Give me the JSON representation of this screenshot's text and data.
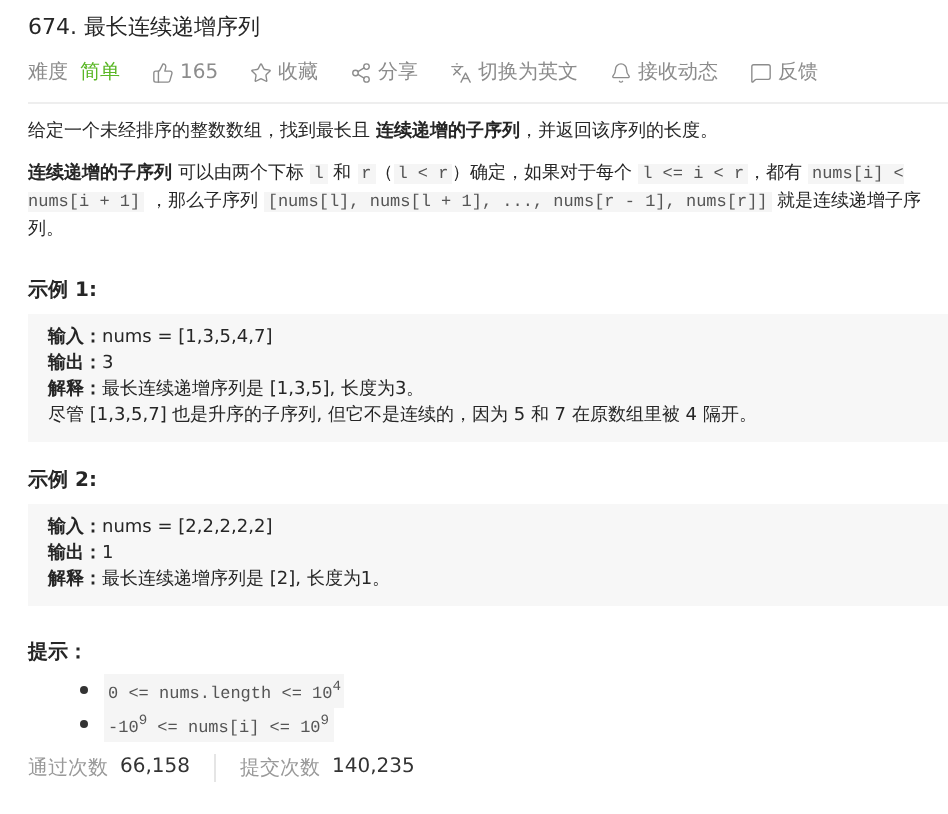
{
  "title": "674. 最长连续递增序列",
  "meta": {
    "difficulty_label": "难度",
    "difficulty": {
      "text": "简单",
      "kind": "easy"
    },
    "actions": [
      {
        "kind": "like",
        "label": "165"
      },
      {
        "kind": "star",
        "label": "收藏"
      },
      {
        "kind": "share",
        "label": "分享"
      },
      {
        "kind": "translate",
        "label": "切换为英文"
      },
      {
        "kind": "bell",
        "label": "接收动态"
      },
      {
        "kind": "feedback",
        "label": "反馈"
      }
    ]
  },
  "description": [
    [
      {
        "kind": "text",
        "text": "给定一个未经排序的整数数组，找到最长且 "
      },
      {
        "kind": "bold",
        "text": "连续递增的子序列"
      },
      {
        "kind": "text",
        "text": "，并返回该序列的长度。"
      }
    ],
    [
      {
        "kind": "bold",
        "text": "连续递增的子序列"
      },
      {
        "kind": "text",
        "text": " 可以由两个下标 "
      },
      {
        "kind": "code",
        "text": "l"
      },
      {
        "kind": "text",
        "text": " 和 "
      },
      {
        "kind": "code",
        "text": "r"
      },
      {
        "kind": "text",
        "text": "（"
      },
      {
        "kind": "code",
        "text": "l < r"
      },
      {
        "kind": "text",
        "text": "）确定，如果对于每个 "
      },
      {
        "kind": "code",
        "text": "l <= i < r"
      },
      {
        "kind": "text",
        "text": "，都有 "
      },
      {
        "kind": "code",
        "text": "nums[i] < nums[i + 1]"
      },
      {
        "kind": "text",
        "text": " ，那么子序列 "
      },
      {
        "kind": "code",
        "text": "[nums[l], nums[l + 1], ..., nums[r - 1], nums[r]]"
      },
      {
        "kind": "text",
        "text": " 就是连续递增子序列。"
      }
    ]
  ],
  "examples": [
    {
      "title": "示例 1:",
      "lines": [
        {
          "label": "输入：",
          "text": "nums = [1,3,5,4,7]"
        },
        {
          "label": "输出：",
          "text": "3"
        },
        {
          "label": "解释：",
          "text": "最长连续递增序列是 [1,3,5], 长度为3。"
        },
        {
          "text": "尽管 [1,3,5,7] 也是升序的子序列, 但它不是连续的，因为 5 和 7 在原数组里被 4 隔开。"
        }
      ]
    },
    {
      "title": "示例 2:",
      "lines": [
        {
          "label": "输入：",
          "text": "nums = [2,2,2,2,2]"
        },
        {
          "label": "输出：",
          "text": "1"
        },
        {
          "label": "解释：",
          "text": "最长连续递增序列是 [2], 长度为1。"
        }
      ]
    }
  ],
  "hints": {
    "title": "提示：",
    "items": [
      "0 <= nums.length <= 10$^{4}$",
      "-10$^{9}$ <= nums[i] <= 10$^{9}$"
    ]
  },
  "stats": [
    {
      "label": "通过次数",
      "value": "66,158"
    },
    {
      "label": "提交次数",
      "value": "140,235"
    }
  ]
}
